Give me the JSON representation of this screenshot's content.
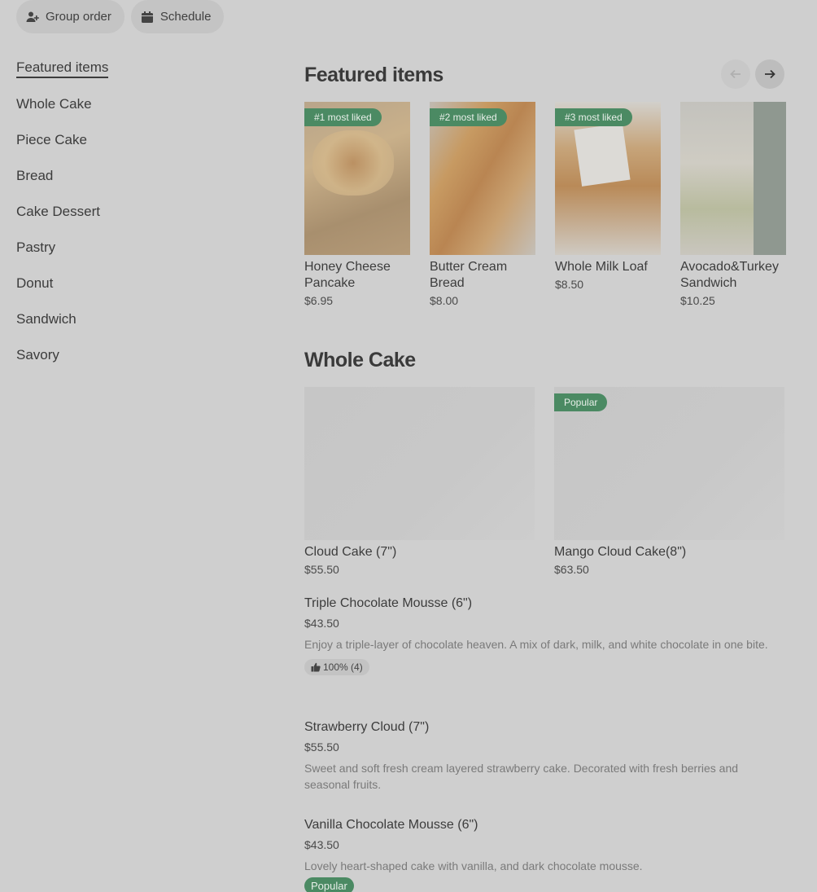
{
  "top": {
    "group_order": "Group order",
    "schedule": "Schedule"
  },
  "sidebar": {
    "items": [
      {
        "label": "Featured items"
      },
      {
        "label": "Whole Cake"
      },
      {
        "label": "Piece Cake"
      },
      {
        "label": "Bread"
      },
      {
        "label": "Cake Dessert"
      },
      {
        "label": "Pastry"
      },
      {
        "label": "Donut"
      },
      {
        "label": "Sandwich"
      },
      {
        "label": "Savory"
      }
    ]
  },
  "featured": {
    "title": "Featured items",
    "items": [
      {
        "badge": "#1 most liked",
        "name": "Honey Cheese Pancake",
        "price": "$6.95"
      },
      {
        "badge": "#2 most liked",
        "name": "Butter Cream Bread",
        "price": "$8.00"
      },
      {
        "badge": "#3 most liked",
        "name": "Whole Milk Loaf",
        "price": "$8.50"
      },
      {
        "badge": "",
        "name": "Avocado&Turkey Sandwich",
        "price": "$10.25"
      }
    ]
  },
  "whole_cake": {
    "title": "Whole Cake",
    "cards": [
      {
        "name": "Cloud Cake (7\")",
        "price": "$55.50",
        "badge": ""
      },
      {
        "name": "Mango Cloud Cake(8\")",
        "price": "$63.50",
        "badge": "Popular"
      }
    ],
    "list": [
      {
        "name": "Triple Chocolate Mousse (6\")",
        "price": "$43.50",
        "desc": "Enjoy a triple-layer of chocolate heaven. A mix of dark, milk, and white chocolate in one bite.",
        "rating": "100% (4)"
      },
      {
        "name": "Strawberry Cloud (7\")",
        "price": "$55.50",
        "desc": "Sweet and soft fresh cream layered strawberry cake. Decorated with fresh berries and seasonal fruits."
      },
      {
        "name": "Vanilla Chocolate Mousse (6\")",
        "price": "$43.50",
        "desc": "Lovely heart-shaped cake with vanilla, and dark chocolate mousse.",
        "badge": "Popular"
      }
    ]
  },
  "colors": {
    "badge_green": "#4b8a63",
    "background": "#cfcfcf"
  }
}
